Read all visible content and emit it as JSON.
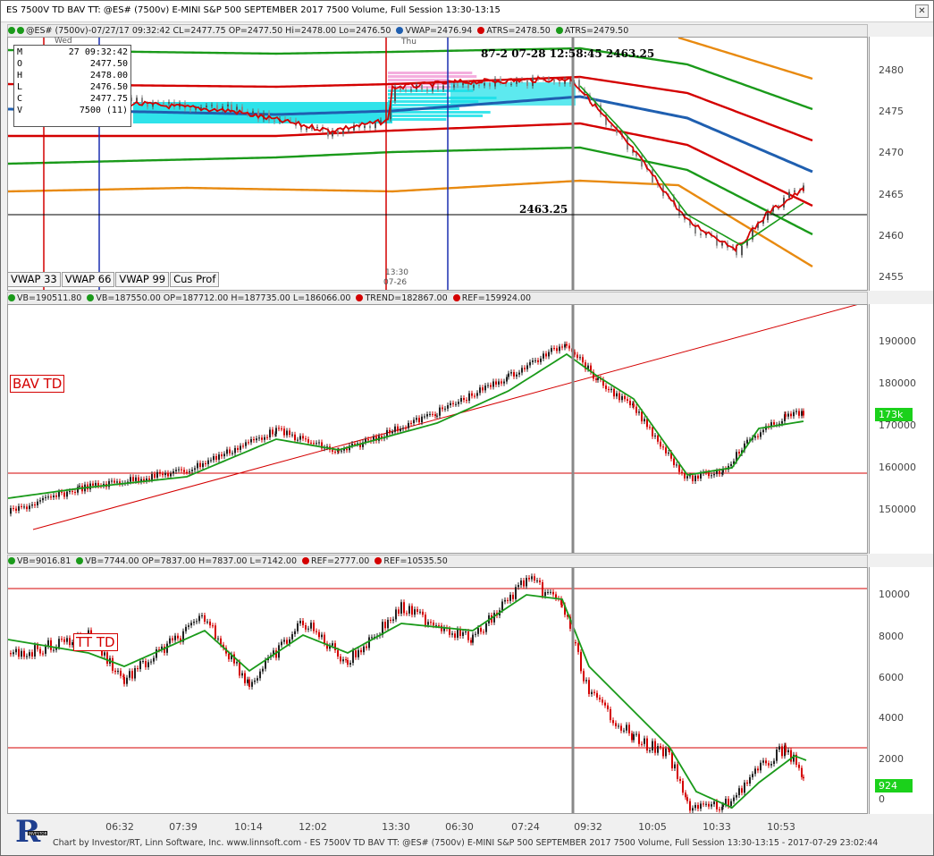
{
  "window": {
    "title": "ES 7500V  TD BAV TT: @ES# (7500v) E-MINI S&P 500 SEPTEMBER 2017 7500 Volume, Full Session 13:30-13:15"
  },
  "pane1": {
    "legend": [
      "@ES# (7500v)-07/27/17 09:32:42 CL=2477.75 OP=2477.50 Hi=2478.00 Lo=2476.50",
      "VWAP=2476.94",
      "ATRS=2478.50",
      "ATRS=2479.50"
    ],
    "legend_colors": [
      "#1a9a1a",
      "#1f5fb0",
      "#d40000",
      "#1a9a1a"
    ],
    "ticks": [
      "2480",
      "2475",
      "2470",
      "2465",
      "2460",
      "2455"
    ],
    "ohlc": [
      {
        "k": "M",
        "v": "27 09:32:42"
      },
      {
        "k": "O",
        "v": "2477.50"
      },
      {
        "k": "H",
        "v": "2478.00"
      },
      {
        "k": "L",
        "v": "2476.50"
      },
      {
        "k": "C",
        "v": "2477.75"
      },
      {
        "k": "V",
        "v": "7500 (11)"
      }
    ],
    "day_labels": [
      "Wed",
      "Thu"
    ],
    "annotation_top": "07-28 12:58:45",
    "annotation_top_prefix": "87-2",
    "annotation_top_value": "2463.25",
    "annotation_mid": "2463.25",
    "small_time": "13:30",
    "small_date": "07-26",
    "tabs": [
      "VWAP 33",
      "VWAP 66",
      "VWAP 99",
      "Cus Prof"
    ]
  },
  "pane2": {
    "legend": [
      "VB=190511.80",
      "VB=187550.00 OP=187712.00 H=187735.00 L=186066.00",
      "TREND=182867.00",
      "REF=159924.00"
    ],
    "legend_colors": [
      "#1a9a1a",
      "#1a9a1a",
      "#d40000",
      "#d40000"
    ],
    "ticks": [
      "190000",
      "180000",
      "170000",
      "160000",
      "150000"
    ],
    "label": "BAV TD",
    "badge": "173k"
  },
  "pane3": {
    "legend": [
      "VB=9016.81",
      "VB=7744.00 OP=7837.00 H=7837.00 L=7142.00",
      "REF=2777.00",
      "REF=10535.50"
    ],
    "legend_colors": [
      "#1a9a1a",
      "#1a9a1a",
      "#d40000",
      "#d40000"
    ],
    "ticks": [
      "10000",
      "8000",
      "6000",
      "4000",
      "2000",
      "0"
    ],
    "label": "TT TD",
    "badge": "924"
  },
  "xaxis": {
    "labels": [
      "06:32",
      "07:39",
      "10:14",
      "12:02",
      "13:30",
      "06:30",
      "07:24",
      "09:32",
      "10:05",
      "10:33",
      "10:53"
    ]
  },
  "footer": "Chart by Investor/RT, Linn Software, Inc. www.linnsoft.com - ES 7500V  TD BAV TT: @ES# (7500v) E-MINI S&P 500 SEPTEMBER 2017 7500 Volume, Full Session 13:30-13:15 - 2017-07-29 23:02:44",
  "logo": {
    "letter": "R",
    "caption": "INVESTOR"
  },
  "mode_button": "M",
  "colors": {
    "up": "#1a9a1a",
    "down": "#d40000",
    "vwap": "#1f5fb0",
    "band": "#e88a10"
  }
}
